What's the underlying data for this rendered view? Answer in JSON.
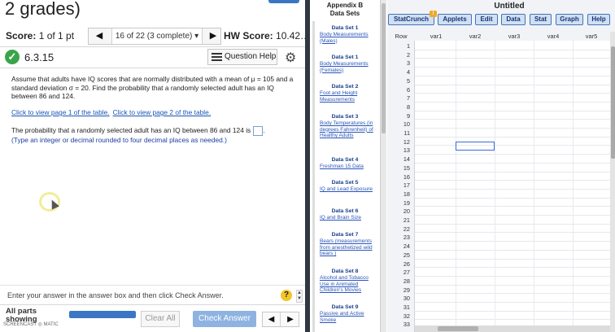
{
  "header": {
    "title_fragment": "2 grades)",
    "score_label": "Score:",
    "score_value": "1 of 1 pt",
    "nav_text": "16 of 22 (3 complete)",
    "hw_score_label": "HW Score:",
    "hw_score_value": "10.42…"
  },
  "question": {
    "number": "6.3.15",
    "help_label": "Question Help",
    "prompt": "Assume that adults have IQ scores that are normally distributed with a mean of μ = 105 and a standard deviation σ = 20. Find the probability that a randomly selected adult has an IQ between 86 and 124.",
    "link1": "Click to view page 1 of the table.",
    "link2": "Click to view page 2 of the table.",
    "answer_text": "The probability that a randomly selected adult has an IQ between 86 and 124 is",
    "hint": "(Type an integer or decimal rounded to four decimal places as needed.)"
  },
  "footer": {
    "enter_hint": "Enter your answer in the answer box and then click Check Answer.",
    "all_parts_1": "All parts",
    "all_parts_2": "showing",
    "watermark": "SCREENCAST ◎ MATIC",
    "clear_label": "Clear All",
    "check_label": "Check Answer",
    "help_q": "?"
  },
  "datasets": {
    "heading_1": "Appendix B",
    "heading_2": "Data Sets",
    "items": [
      {
        "title": "Data Set 1",
        "link": "Body Measurements (Males)"
      },
      {
        "title": "Data Set 1",
        "link": "Body Measurements (Females)"
      },
      {
        "title": "Data Set 2",
        "link": "Foot and Height Measurements"
      },
      {
        "title": "Data Set 3",
        "link": "Body Temperatures (in degrees Fahrenheit) of Healthy Adults"
      },
      {
        "title": "Data Set 4",
        "link": "Freshman 15 Data"
      },
      {
        "title": "Data Set 5",
        "link": "IQ and Lead Exposure"
      },
      {
        "title": "Data Set 6",
        "link": "IQ and Brain Size"
      },
      {
        "title": "Data Set 7",
        "link": "Bears (measurements from anesthetized wild bears )"
      },
      {
        "title": "Data Set 8",
        "link": "Alcohol and Tobacco Use in Animated Children's Movies"
      },
      {
        "title": "Data Set 9",
        "link": "Passive and Active Smoke"
      }
    ]
  },
  "statcrunch": {
    "title": "Untitled",
    "menu": [
      "StatCrunch",
      "Applets",
      "Edit",
      "Data",
      "Stat",
      "Graph",
      "Help"
    ],
    "badge": "!",
    "row_header": "Row",
    "columns": [
      "var1",
      "var2",
      "var3",
      "var4",
      "var5"
    ],
    "rows": [
      "1",
      "2",
      "3",
      "4",
      "5",
      "6",
      "7",
      "8",
      "9",
      "10",
      "11",
      "12",
      "13",
      "14",
      "15",
      "16",
      "17",
      "18",
      "19",
      "20",
      "21",
      "22",
      "23",
      "24",
      "25",
      "26",
      "27",
      "28",
      "29",
      "30",
      "31",
      "32",
      "33"
    ]
  }
}
